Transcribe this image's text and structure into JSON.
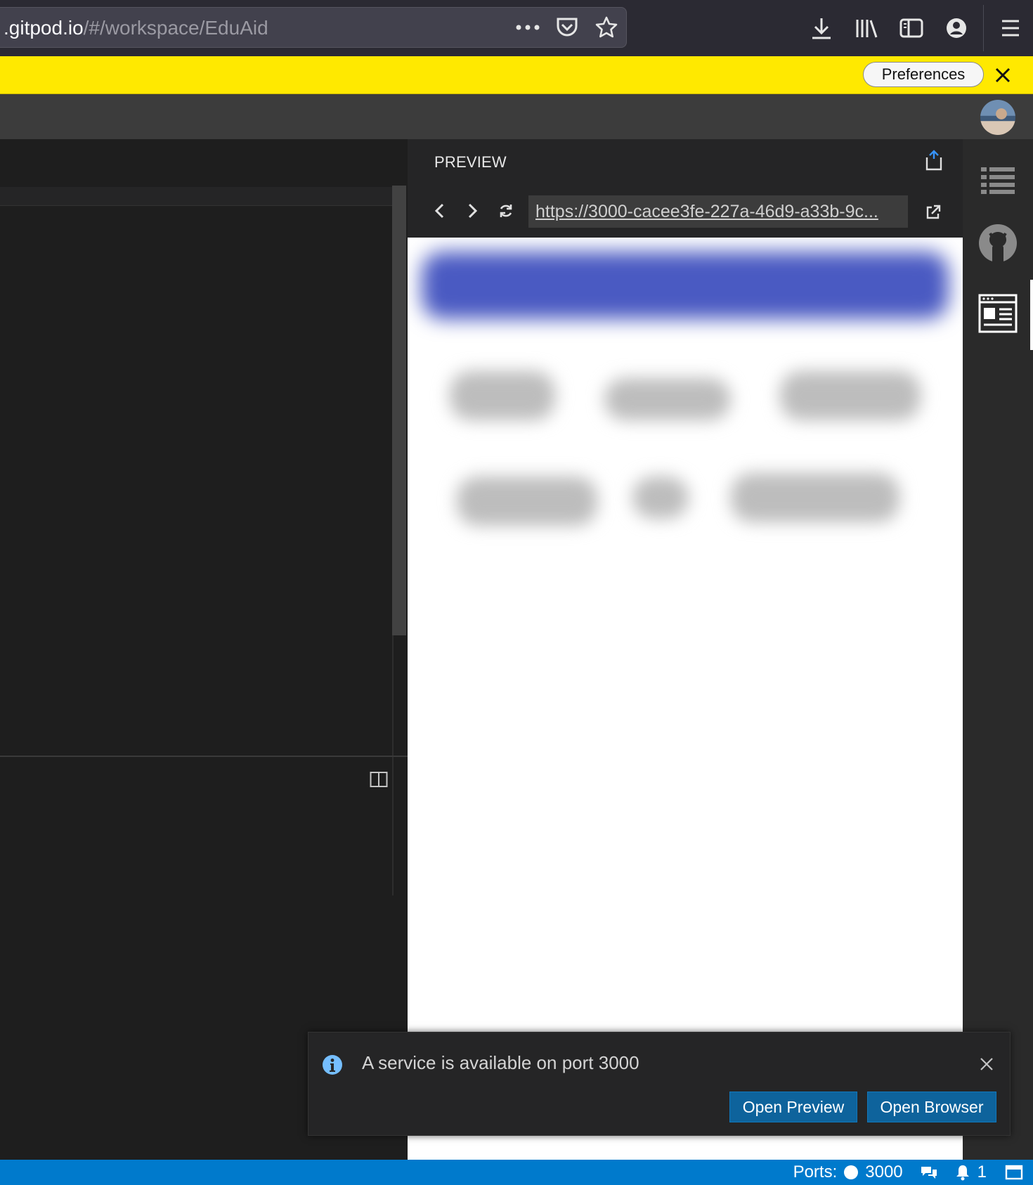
{
  "browser": {
    "url_host": ".gitpod.io",
    "url_path": "/#/workspace/EduAid"
  },
  "notification_bar": {
    "preferences_label": "Preferences"
  },
  "preview": {
    "title": "PREVIEW",
    "url": "https://3000-cacee3fe-227a-46d9-a33b-9c..."
  },
  "toast": {
    "message": "A service is available on port 3000",
    "open_preview_label": "Open Preview",
    "open_browser_label": "Open Browser"
  },
  "statusbar": {
    "ports_label": "Ports:",
    "port_value": "3000",
    "notification_count": "1"
  },
  "colors": {
    "accent": "#007acc",
    "button": "#0e639c",
    "yellow_bar": "#ffe900"
  }
}
